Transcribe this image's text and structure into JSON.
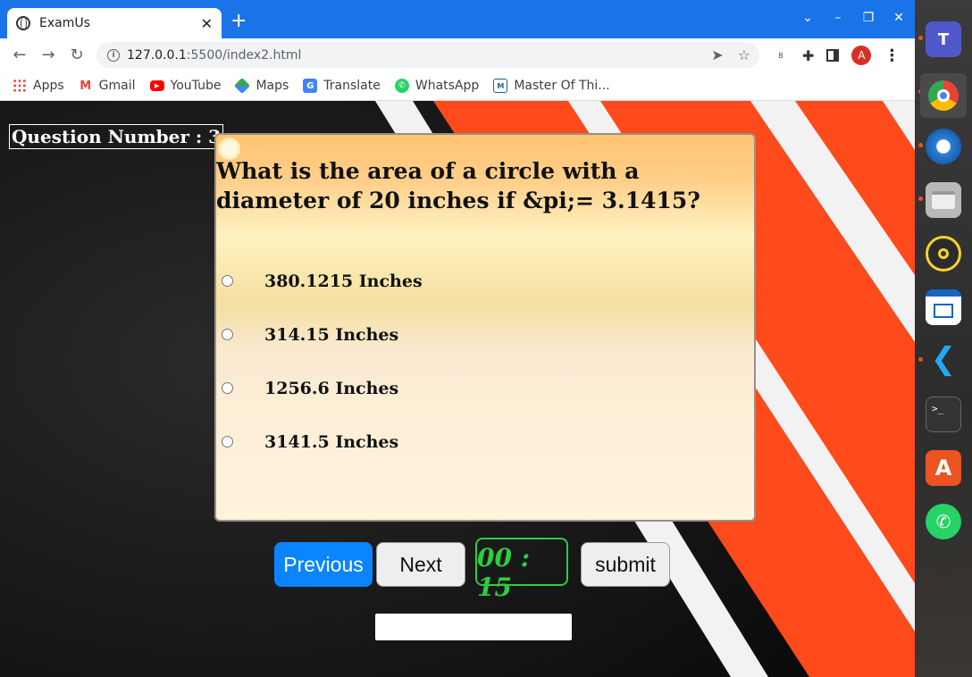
{
  "browser": {
    "tab_title": "ExamUs",
    "url_host": "127.0.0.1",
    "url_rest": ":5500/index2.html",
    "profile_initial": "A",
    "extension_label": "B"
  },
  "bookmarks": [
    {
      "label": "Apps",
      "icon": "apps-grid-icon"
    },
    {
      "label": "Gmail",
      "icon": "gmail-icon"
    },
    {
      "label": "YouTube",
      "icon": "youtube-icon"
    },
    {
      "label": "Maps",
      "icon": "maps-icon"
    },
    {
      "label": "Translate",
      "icon": "translate-icon"
    },
    {
      "label": "WhatsApp",
      "icon": "whatsapp-icon"
    },
    {
      "label": "Master Of Thi...",
      "icon": "master-of-thi-icon"
    }
  ],
  "quiz": {
    "question_number_label": "Question Number : 3",
    "question": "What is the area of a circle with a diameter of 20 inches if &pi;= 3.1415?",
    "options": [
      "380.1215 Inches",
      "314.15 Inches",
      "1256.6 Inches",
      "3141.5 Inches"
    ],
    "prev_label": "Previous",
    "next_label": "Next",
    "timer": "00 : 15",
    "submit_label": "submit"
  },
  "colors": {
    "chrome_blue": "#1a73e8",
    "previous_button": "#0a84ff",
    "timer_green": "#2ecc40",
    "stripe_orange": "#ff4a1c"
  },
  "dock": [
    "teams-icon",
    "chrome-icon",
    "thunderbird-icon",
    "files-icon",
    "rhythmbox-icon",
    "writer-icon",
    "vscode-icon",
    "terminal-icon",
    "software-center-icon",
    "whatsapp-icon"
  ]
}
